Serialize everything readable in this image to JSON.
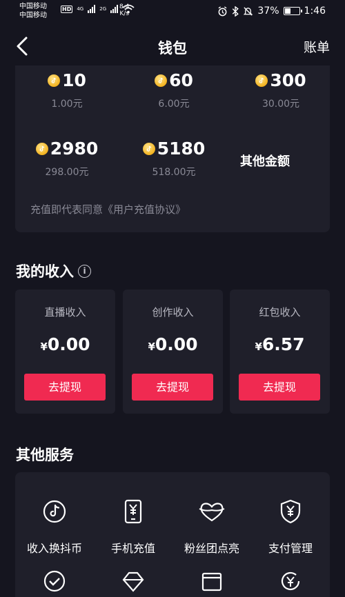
{
  "status_bar": {
    "carrier1": "中国移动",
    "carrier2": "中国移动",
    "hd": "HD",
    "gen1": "4G",
    "gen2": "2G",
    "speed_value": "8.4",
    "speed_unit": "K/s",
    "battery": "37%",
    "time": "1:46"
  },
  "nav": {
    "title": "钱包",
    "bill": "账单"
  },
  "recharge": {
    "packages": [
      {
        "coins": "10",
        "price": "1.00元"
      },
      {
        "coins": "60",
        "price": "6.00元"
      },
      {
        "coins": "300",
        "price": "30.00元"
      },
      {
        "coins": "2980",
        "price": "298.00元"
      },
      {
        "coins": "5180",
        "price": "518.00元"
      }
    ],
    "other_amount": "其他金额",
    "agreement": "充值即代表同意《用户充值协议》"
  },
  "income": {
    "title": "我的收入",
    "info_icon": "i",
    "currency": "¥",
    "items": [
      {
        "label": "直播收入",
        "value": "0.00",
        "button": "去提现"
      },
      {
        "label": "创作收入",
        "value": "0.00",
        "button": "去提现"
      },
      {
        "label": "红包收入",
        "value": "6.57",
        "button": "去提现"
      }
    ]
  },
  "services": {
    "title": "其他服务",
    "items": [
      {
        "label": "收入换抖币",
        "icon": "tiktok-note-icon"
      },
      {
        "label": "手机充值",
        "icon": "phone-yuan-icon"
      },
      {
        "label": "粉丝团点亮",
        "icon": "fan-heart-icon"
      },
      {
        "label": "支付管理",
        "icon": "shield-yuan-icon"
      }
    ]
  },
  "colors": {
    "background": "#15151f",
    "card": "#1f1f2a",
    "accent": "#f02a51",
    "coin": "#f3b320",
    "muted_text": "#8a8a96"
  }
}
